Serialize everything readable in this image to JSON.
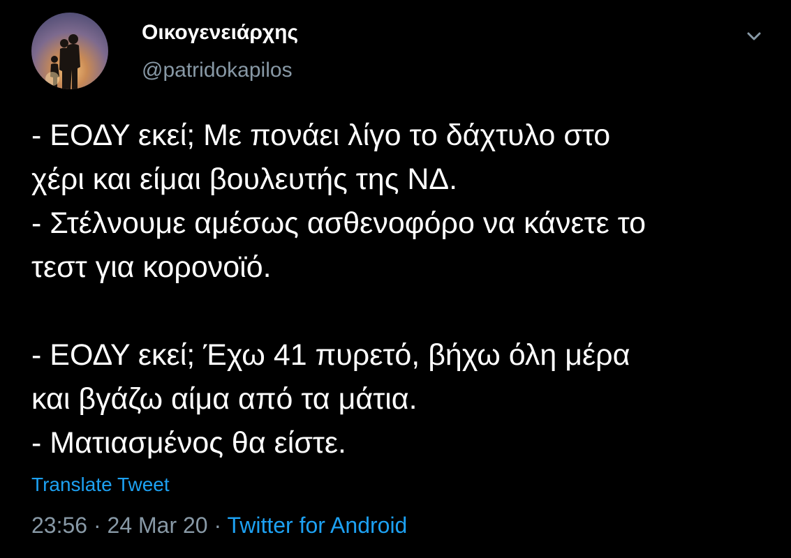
{
  "author": {
    "display_name": "Οικογενειάρχης",
    "handle": "@patridokapilos"
  },
  "tweet": {
    "lines": [
      "- ΕΟΔΥ εκεί; Με πονάει λίγο το δάχτυλο στο",
      "χέρι και είμαι βουλευτής της ΝΔ.",
      "- Στέλνουμε αμέσως ασθενοφόρο να κάνετε το",
      "τεστ για κορονοϊό.",
      "- ΕΟΔΥ εκεί; Έχω 41 πυρετό, βήχω όλη μέρα",
      "και βγάζω αίμα από τα μάτια.",
      "- Ματιασμένος θα είστε."
    ]
  },
  "translate_label": "Translate Tweet",
  "meta": {
    "time": "23:56",
    "separator": "·",
    "date": "24 Mar 20",
    "source": "Twitter for Android"
  },
  "icons": {
    "chevron": "chevron-down-icon",
    "avatar": "avatar-family-silhouette"
  },
  "colors": {
    "background": "#000000",
    "text": "#ffffff",
    "secondary": "#8899a6",
    "link": "#1da1f2"
  }
}
